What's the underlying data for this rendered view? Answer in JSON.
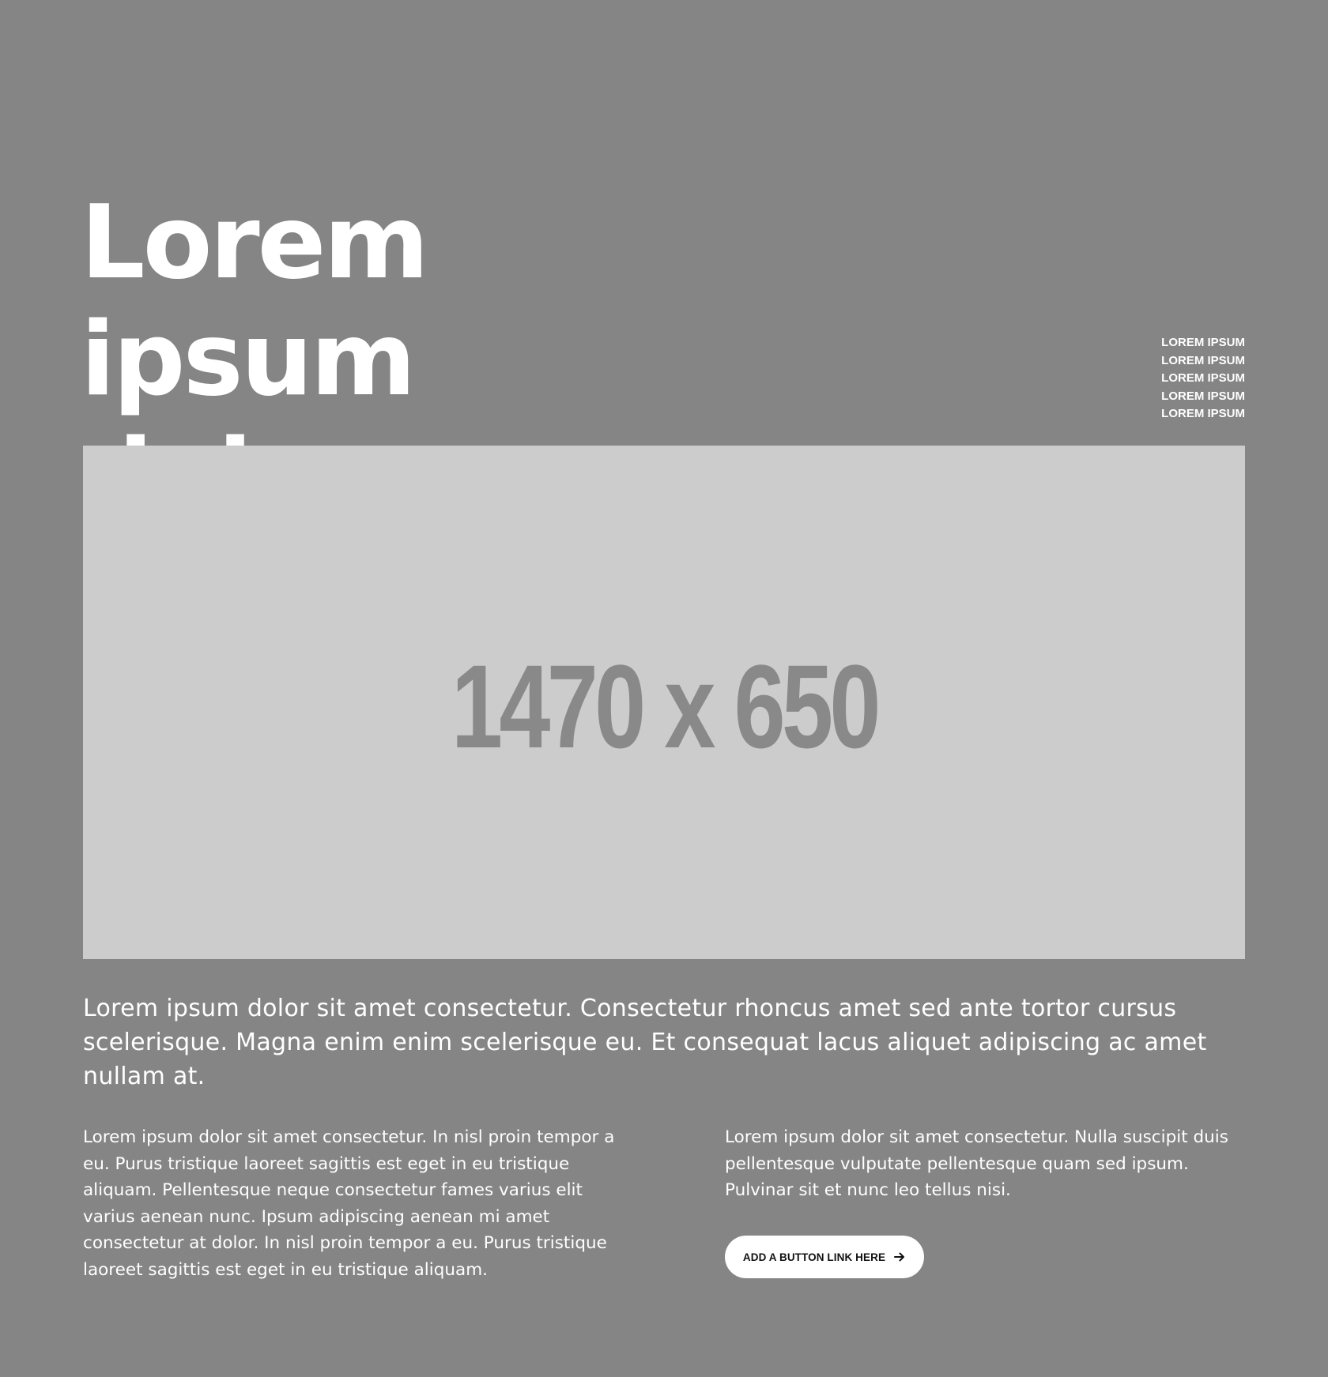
{
  "hero": {
    "title_line1": "Lorem ipsum",
    "title_line2": "dolor"
  },
  "side_links": [
    "LOREM IPSUM",
    "LOREM IPSUM",
    "LOREM IPSUM",
    "LOREM IPSUM",
    "LOREM IPSUM"
  ],
  "image": {
    "placeholder_text": "1470 x 650"
  },
  "lead": "Lorem ipsum dolor sit amet consectetur. Consectetur rhoncus amet sed ante tortor cursus scelerisque. Magna enim enim scelerisque eu. Et consequat lacus aliquet adipiscing ac amet nullam at.",
  "columns": {
    "left": "Lorem ipsum dolor sit amet consectetur. In nisl proin tempor a eu. Purus tristique laoreet sagittis est eget in eu tristique aliquam. Pellentesque neque consectetur fames varius elit varius aenean nunc. Ipsum adipiscing aenean mi amet consectetur at dolor. In nisl proin tempor a eu. Purus tristique laoreet sagittis est eget in eu tristique aliquam.",
    "right": "Lorem ipsum dolor sit amet consectetur. Nulla suscipit duis pellentesque vulputate pellentesque quam sed ipsum. Pulvinar sit et nunc leo tellus nisi."
  },
  "cta": {
    "label": "ADD A BUTTON LINK HERE",
    "icon": "arrow-right-icon"
  },
  "colors": {
    "background": "#858585",
    "image_placeholder": "#cccccc",
    "placeholder_text": "#898989",
    "text": "#ffffff",
    "button_bg": "#ffffff",
    "button_text": "#111111"
  }
}
